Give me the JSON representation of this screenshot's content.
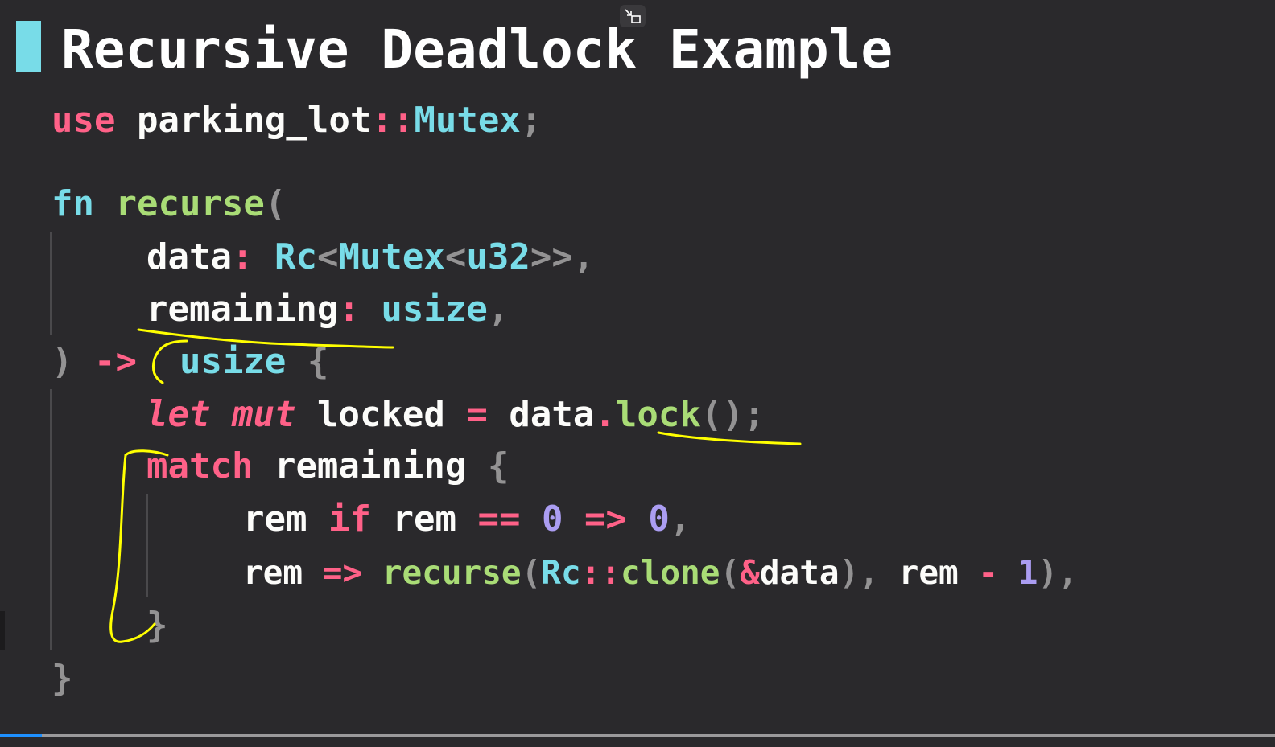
{
  "slide": {
    "title": "Recursive Deadlock Example"
  },
  "controls": {
    "exit_fullscreen_icon": "exit-fullscreen-icon"
  },
  "colors": {
    "background": "#2a292c",
    "keyword": "#ff6188",
    "type": "#78dce8",
    "function": "#a9dc76",
    "number": "#ab9df2",
    "identifier": "#fcfcfa",
    "punctuation": "#939293",
    "annotation": "#ffff00",
    "title_accent": "#78dce8"
  },
  "code": {
    "line1": {
      "kw": "use",
      "path": "parking_lot",
      "sep": "::",
      "ty": "Mutex",
      "end": ";"
    },
    "line2": {
      "kw": "fn",
      "name": "recurse",
      "open": "("
    },
    "line3": {
      "param": "data",
      "colon": ":",
      "ty1": "Rc",
      "lt1": "<",
      "ty2": "Mutex",
      "lt2": "<",
      "ty3": "u32",
      "gt": ">>",
      "comma": ","
    },
    "line4": {
      "param": "remaining",
      "colon": ":",
      "ty": "usize",
      "comma": ","
    },
    "line5": {
      "close": ")",
      "arrow": "->",
      "ty": "usize",
      "brace": "{"
    },
    "line6": {
      "kw1": "let",
      "kw2": "mut",
      "var": "locked",
      "eq": "=",
      "obj": "data",
      "dot": ".",
      "method": "lock",
      "parens": "()",
      "semi": ";"
    },
    "line7": {
      "kw": "match",
      "var": "remaining",
      "brace": "{"
    },
    "line8": {
      "var1": "rem",
      "kw": "if",
      "var2": "rem",
      "op": "==",
      "n1": "0",
      "arrow": "=>",
      "n2": "0",
      "comma": ","
    },
    "line9": {
      "var": "rem",
      "arrow": "=>",
      "fn": "recurse",
      "open": "(",
      "ty": "Rc",
      "sep": "::",
      "fn2": "clone",
      "open2": "(",
      "amp": "&",
      "arg": "data",
      "close2": ")",
      "comma1": ",",
      "var2": "rem",
      "op": "-",
      "n": "1",
      "close": ")",
      "comma2": ","
    },
    "line10": {
      "brace": "}"
    },
    "line11": {
      "brace": "}"
    }
  }
}
